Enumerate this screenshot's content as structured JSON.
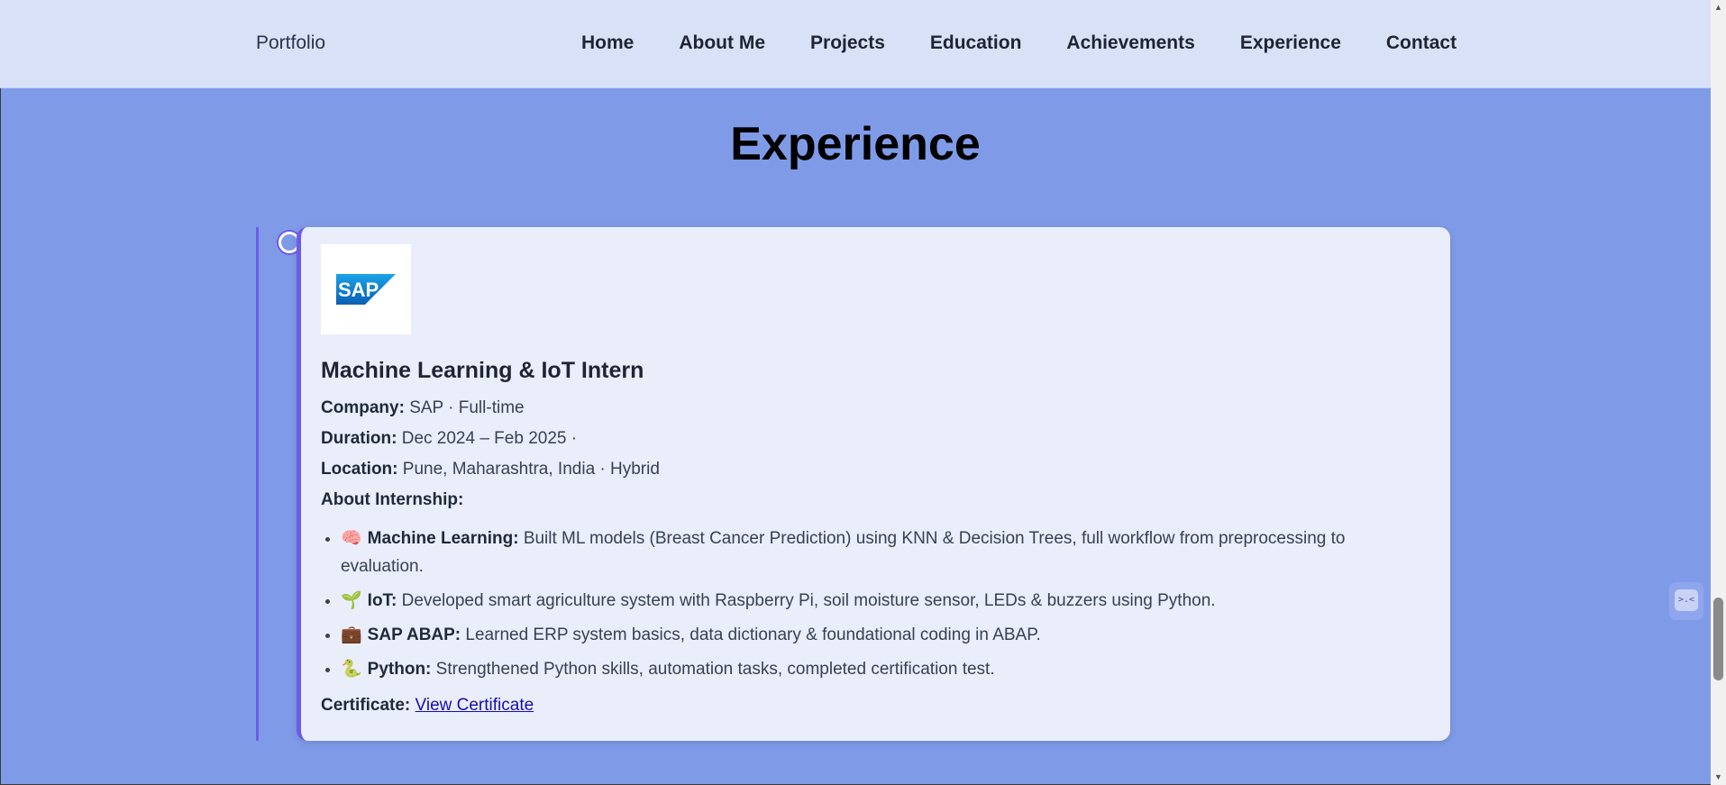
{
  "nav": {
    "brand": "Portfolio",
    "links": [
      "Home",
      "About Me",
      "Projects",
      "Education",
      "Achievements",
      "Experience",
      "Contact"
    ]
  },
  "section": {
    "title": "Experience"
  },
  "experience": {
    "logo_text": "SAP",
    "role": "Machine Learning & IoT Intern",
    "company_label": "Company:",
    "company_value": "SAP · Full-time",
    "duration_label": "Duration:",
    "duration_value": "Dec 2024 – Feb 2025 ·",
    "location_label": "Location:",
    "location_value": "Pune, Maharashtra, India · Hybrid",
    "about_label": "About Internship:",
    "points": [
      {
        "emoji": "🧠",
        "title": "Machine Learning:",
        "text": "Built ML models (Breast Cancer Prediction) using KNN & Decision Trees, full workflow from preprocessing to evaluation."
      },
      {
        "emoji": "🌱",
        "title": "IoT:",
        "text": "Developed smart agriculture system with Raspberry Pi, soil moisture sensor, LEDs & buzzers using Python."
      },
      {
        "emoji": "💼",
        "title": "SAP ABAP:",
        "text": "Learned ERP system basics, data dictionary & foundational coding in ABAP."
      },
      {
        "emoji": "🐍",
        "title": "Python:",
        "text": "Strengthened Python skills, automation tasks, completed certification test."
      }
    ],
    "certificate_label": "Certificate:",
    "certificate_link": "View Certificate"
  },
  "widget": {
    "face": ">.<"
  },
  "colors": {
    "page_bg": "#7f9be8",
    "nav_bg": "#d9e1f7",
    "card_bg": "#eaeefb",
    "accent": "#6d5be6",
    "sap_blue": "#0a6ed1"
  }
}
